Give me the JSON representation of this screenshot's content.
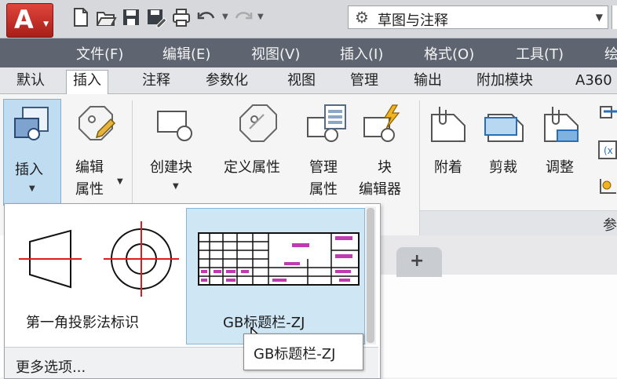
{
  "app": {
    "logo_letter": "A",
    "workspace": "草图与注释"
  },
  "menu": [
    "文件(F)",
    "编辑(E)",
    "视图(V)",
    "插入(I)",
    "格式(O)",
    "工具(T)",
    "绘"
  ],
  "tabs": [
    "默认",
    "插入",
    "注释",
    "参数化",
    "视图",
    "管理",
    "输出",
    "附加模块",
    "A360"
  ],
  "ribbon": {
    "insert_l1": "插入",
    "edit_attr_l1": "编辑",
    "edit_attr_l2": "属性",
    "create_block": "创建块",
    "define_attr": "定义属性",
    "manage_attr_l1": "管理",
    "manage_attr_l2": "属性",
    "block_editor_l1": "块",
    "block_editor_l2": "编辑器",
    "attach": "附着",
    "clip": "剪裁",
    "adjust": "调整",
    "reference_panel_title": "参"
  },
  "gallery": {
    "items": [
      "第一角投影法标识",
      "GB标题栏-ZJ"
    ],
    "more": "更多选项...",
    "tooltip": "GB标题栏-ZJ"
  },
  "filetab_new": "+",
  "colors": {
    "accent_red": "#d43b2f",
    "hover_blue": "#cfe6f5",
    "menubar": "#5e6570",
    "magenta": "#c03ab0"
  }
}
